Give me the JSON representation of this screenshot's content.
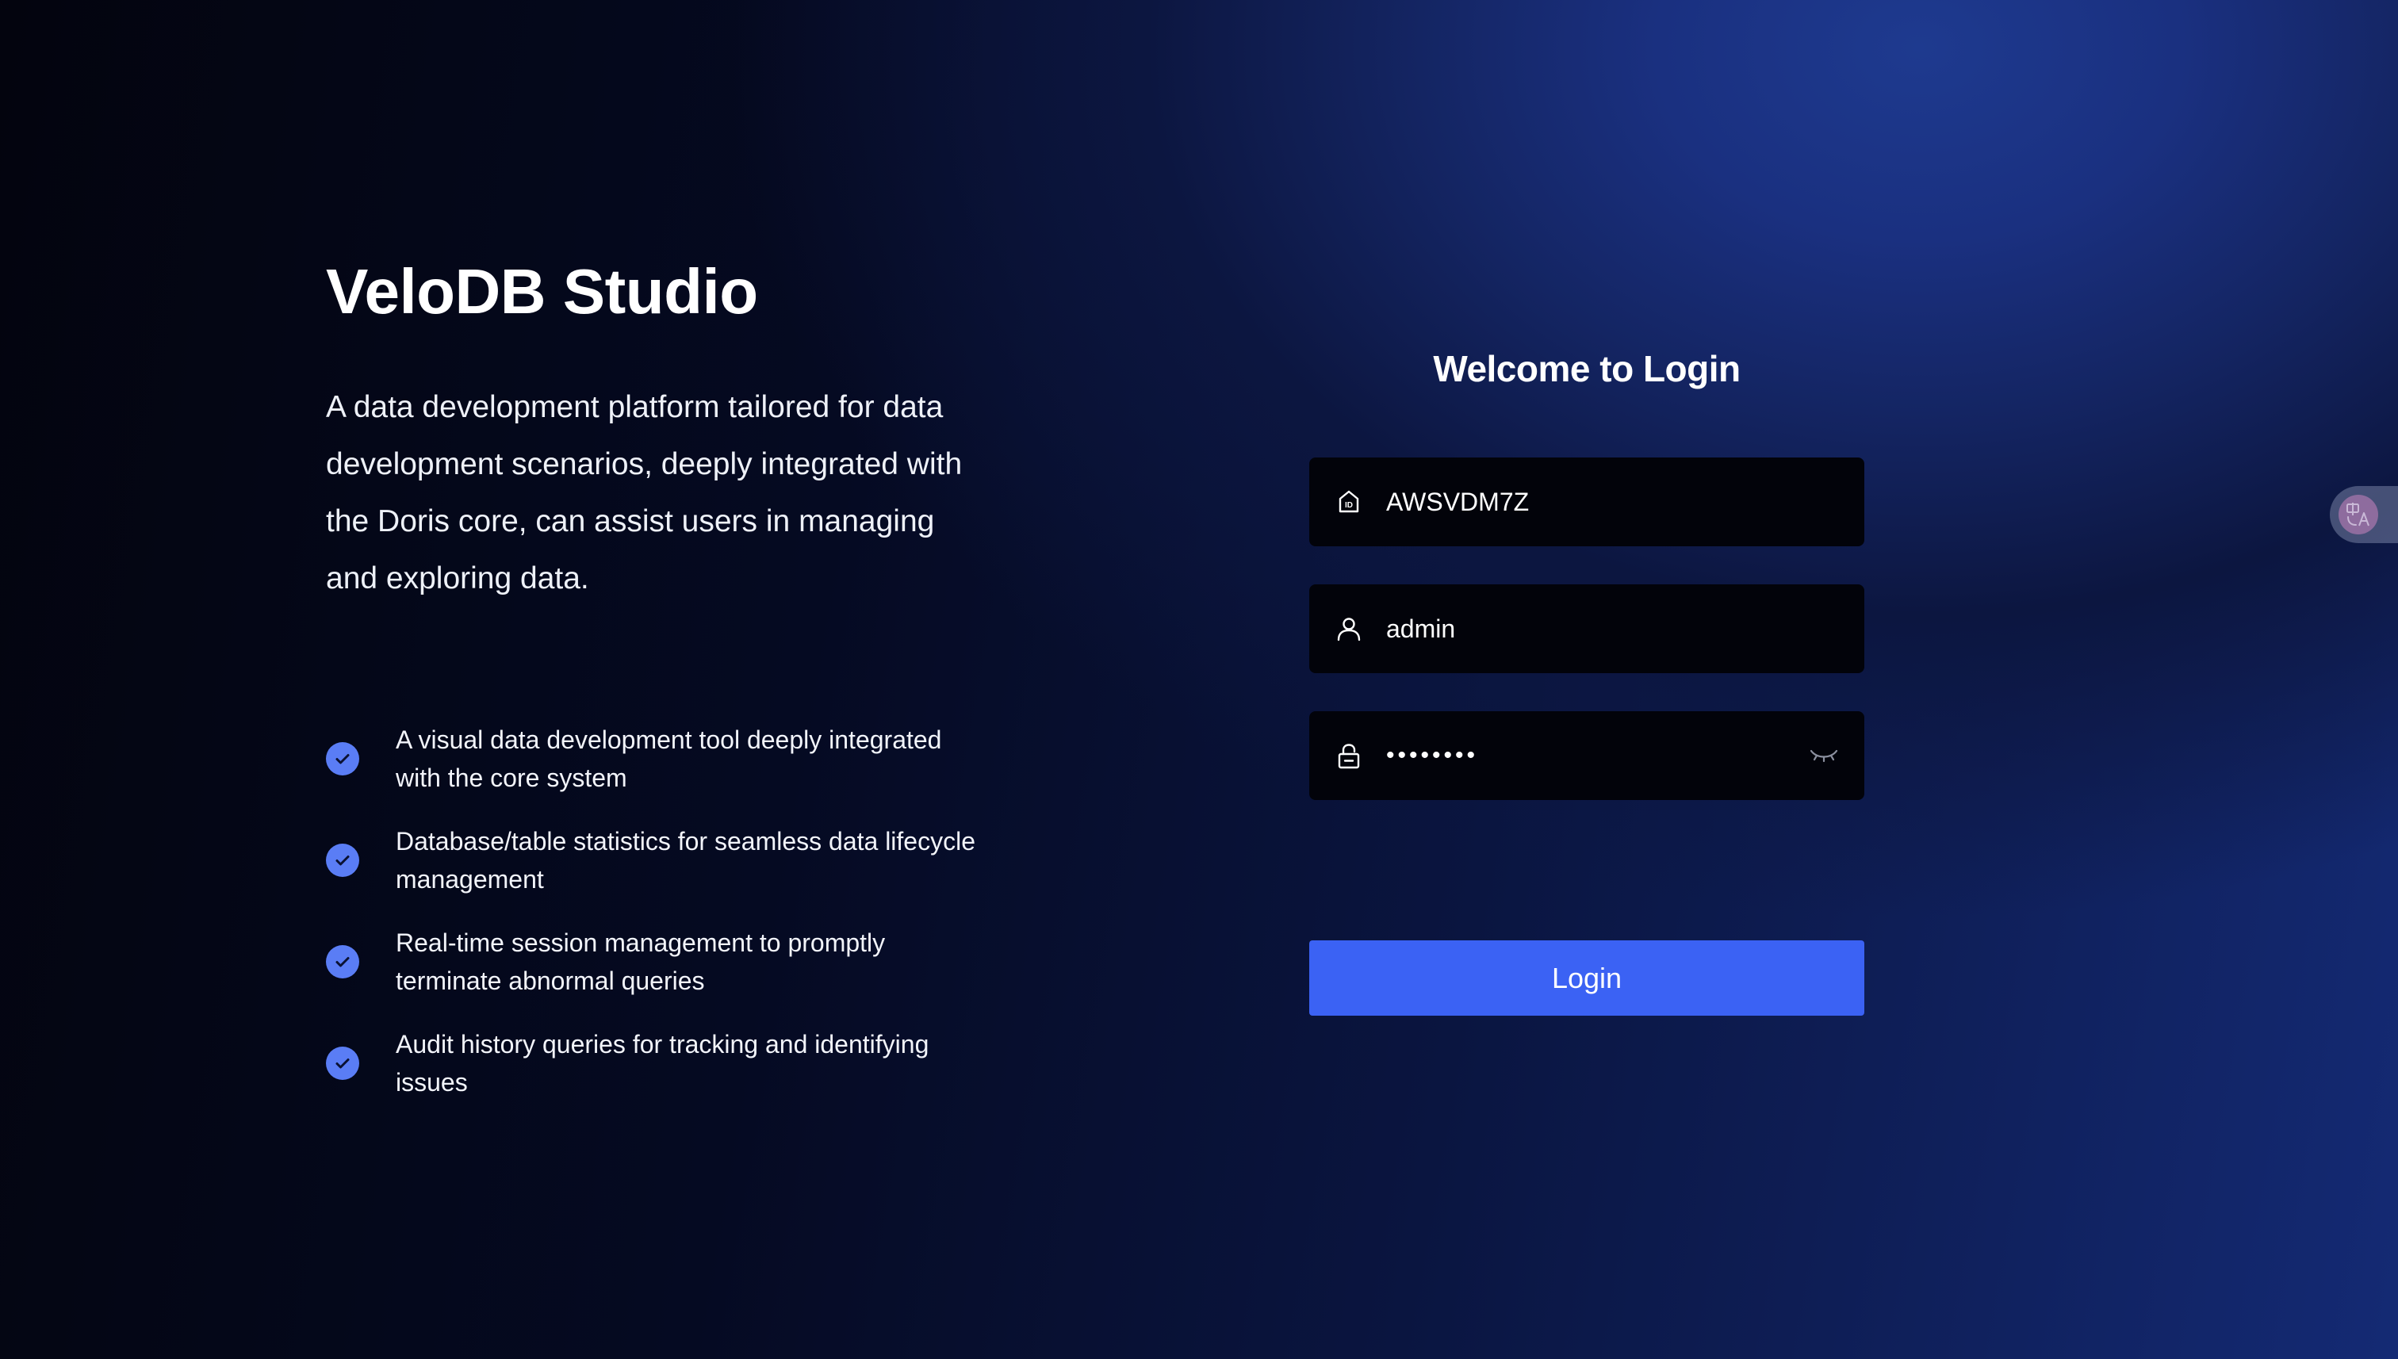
{
  "brand": {
    "title": "VeloDB Studio",
    "description": "A data development platform tailored for data development scenarios, deeply integrated with the Doris core, can assist users in managing and exploring data."
  },
  "features": [
    {
      "text": "A visual data development tool deeply integrated with the core system",
      "icon": "check-circle-icon"
    },
    {
      "text": "Database/table statistics for seamless data lifecycle management",
      "icon": "check-circle-icon"
    },
    {
      "text": "Real-time session management to promptly terminate abnormal queries",
      "icon": "check-circle-icon"
    },
    {
      "text": "Audit history queries for tracking and identifying issues",
      "icon": "check-circle-icon"
    }
  ],
  "login": {
    "title": "Welcome to Login",
    "cluster_id": {
      "value": "AWSVDM7Z",
      "icon": "id-badge-icon"
    },
    "username": {
      "value": "admin",
      "icon": "user-icon"
    },
    "password": {
      "value": "12345678",
      "icon": "lock-icon",
      "toggle_icon": "eye-closed-icon"
    },
    "button_label": "Login"
  },
  "translate_widget": {
    "icon": "translate-icon"
  },
  "colors": {
    "accent": "#3b62f4",
    "check": "#5a7df5",
    "field_bg": "#02030a"
  }
}
